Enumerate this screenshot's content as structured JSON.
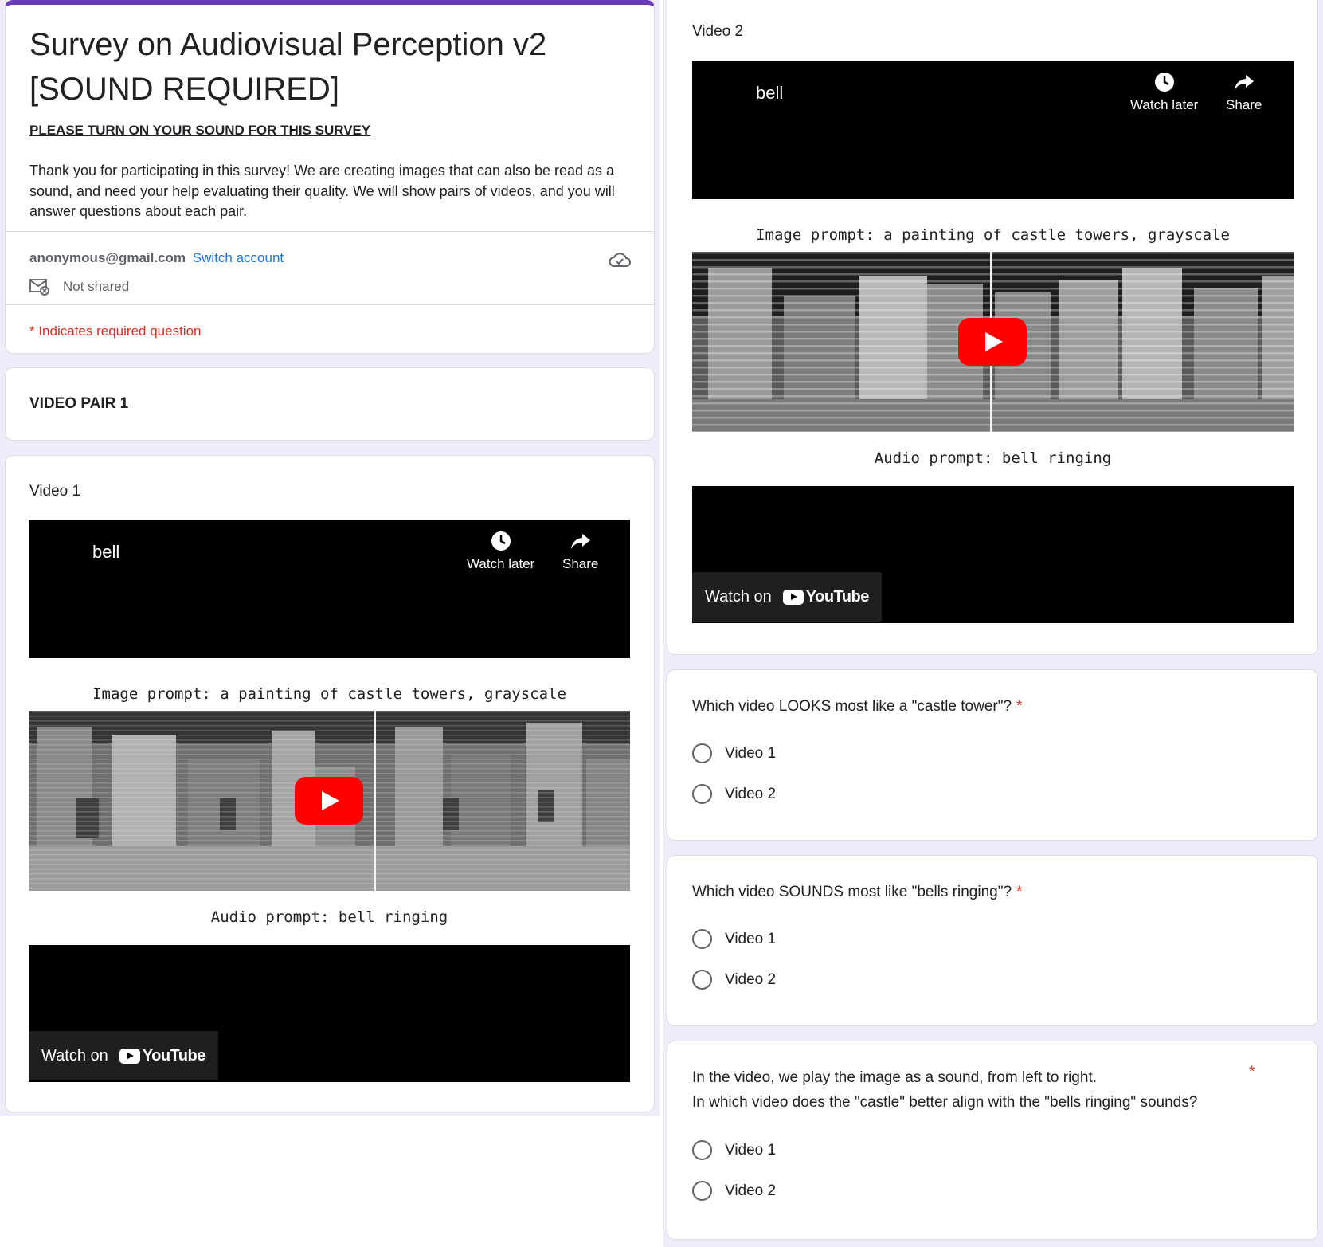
{
  "form": {
    "title": "Survey on Audiovisual Perception v2 [SOUND REQUIRED]",
    "sound_notice": "PLEASE TURN ON YOUR SOUND FOR THIS SURVEY",
    "description": "Thank you for participating in this survey! We are creating images that can also be read as a sound, and need your help evaluating their quality. We will show pairs of videos, and you will answer questions about each pair.",
    "account_email": "anonymous@gmail.com",
    "switch_account": "Switch account",
    "not_shared": "Not shared",
    "required_note": "* Indicates required question",
    "accent_color": "#673ab7",
    "link_color": "#1a73e8",
    "required_color": "#d93025"
  },
  "section": {
    "title": "VIDEO PAIR 1"
  },
  "videos": [
    {
      "label": "Video 1",
      "yt_title": "bell",
      "watch_later": "Watch later",
      "share": "Share",
      "image_prompt": "Image prompt: a painting of castle towers, grayscale",
      "audio_prompt": "Audio prompt: bell ringing",
      "watch_on": "Watch on",
      "youtube": "YouTube"
    },
    {
      "label": "Video 2",
      "yt_title": "bell",
      "watch_later": "Watch later",
      "share": "Share",
      "image_prompt": "Image prompt: a painting of castle towers, grayscale",
      "audio_prompt": "Audio prompt: bell ringing",
      "watch_on": "Watch on",
      "youtube": "YouTube"
    }
  ],
  "questions": [
    {
      "text": "Which video LOOKS most like a \"castle tower\"?",
      "required": "*",
      "options": [
        "Video 1",
        "Video 2"
      ]
    },
    {
      "text": "Which video SOUNDS most like \"bells ringing\"?",
      "required": "*",
      "options": [
        "Video 1",
        "Video 2"
      ]
    },
    {
      "line1": "In the video, we play the image as a sound, from left to right.",
      "line2": "In which video does the \"castle\" better align with the \"bells ringing\" sounds?",
      "required": "*",
      "options": [
        "Video 1",
        "Video 2"
      ]
    }
  ]
}
